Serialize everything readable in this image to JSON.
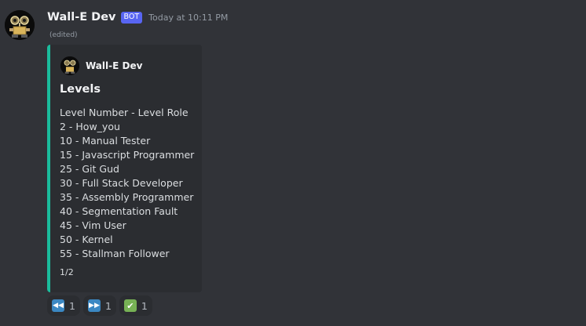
{
  "message": {
    "username": "Wall-E Dev",
    "bot_tag": "BOT",
    "timestamp": "Today at 10:11 PM",
    "edited_label": "(edited)"
  },
  "embed": {
    "accent_color": "#1abc9c",
    "author_name": "Wall-E Dev",
    "title": "Levels",
    "lines": [
      "Level Number - Level Role",
      "2 - How_you",
      "10 - Manual Tester",
      "15 - Javascript Programmer",
      "25 - Git Gud",
      "30 - Full Stack Developer",
      "35 - Assembly Programmer",
      "40 - Segmentation Fault",
      "45 - Vim User",
      "50 - Kernel",
      "55 - Stallman Follower"
    ],
    "footer": "1/2"
  },
  "reactions": [
    {
      "icon": "rewind-icon",
      "count": "1"
    },
    {
      "icon": "fast-forward-icon",
      "count": "1"
    },
    {
      "icon": "check-mark-icon",
      "count": "1"
    }
  ],
  "colors": {
    "background": "#313338",
    "embed_background": "#2b2d31",
    "bot_tag": "#5865f2"
  }
}
